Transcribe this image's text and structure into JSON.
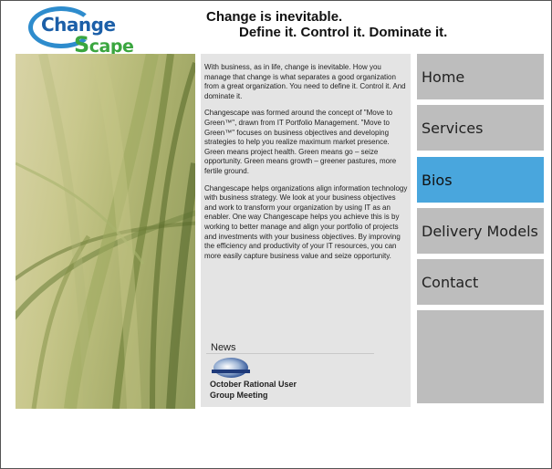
{
  "brand": {
    "logo_part1": "Change",
    "logo_part2": "cape",
    "logo_s": "S"
  },
  "tagline": {
    "line1": "Change is inevitable.",
    "line2": "Define it.  Control it.  Dominate it."
  },
  "content": {
    "paragraphs": [
      "With business, as in life, change is inevitable.  How you manage that change is  what separates a good organization from a great organization. You need to define it. Control it. And dominate it.",
      "Changescape was formed around the concept of \"Move to Green™\", drawn from IT Portfolio Management. \"Move to Green™\" focuses on business objectives and developing strategies to help you realize maximum market presence. Green means project health.  Green means go – seize opportunity.  Green means growth – greener pastures, more fertile ground.",
      "Changescape helps organizations align information technology with business strategy. We look at your business objectives and work to transform your organization by using IT as an enabler.  One way Changescape helps you achieve this is by working to better manage and align your portfolio of projects and investments with your business objectives. By improving the efficiency and productivity of your IT resources, you can more easily capture business value and seize opportunity."
    ]
  },
  "news": {
    "heading": "News",
    "item_text": "October Rational User Group Meeting"
  },
  "nav": {
    "items": [
      {
        "label": "Home",
        "active": false
      },
      {
        "label": "Services",
        "active": false
      },
      {
        "label": "Bios",
        "active": true
      },
      {
        "label": "Delivery Models",
        "active": false
      },
      {
        "label": "Contact",
        "active": false
      }
    ],
    "active_color": "#49a6dd",
    "inactive_color": "#bdbdbd"
  },
  "colors": {
    "logo_blue": "#1c5fa8",
    "logo_green": "#3aa63f"
  }
}
